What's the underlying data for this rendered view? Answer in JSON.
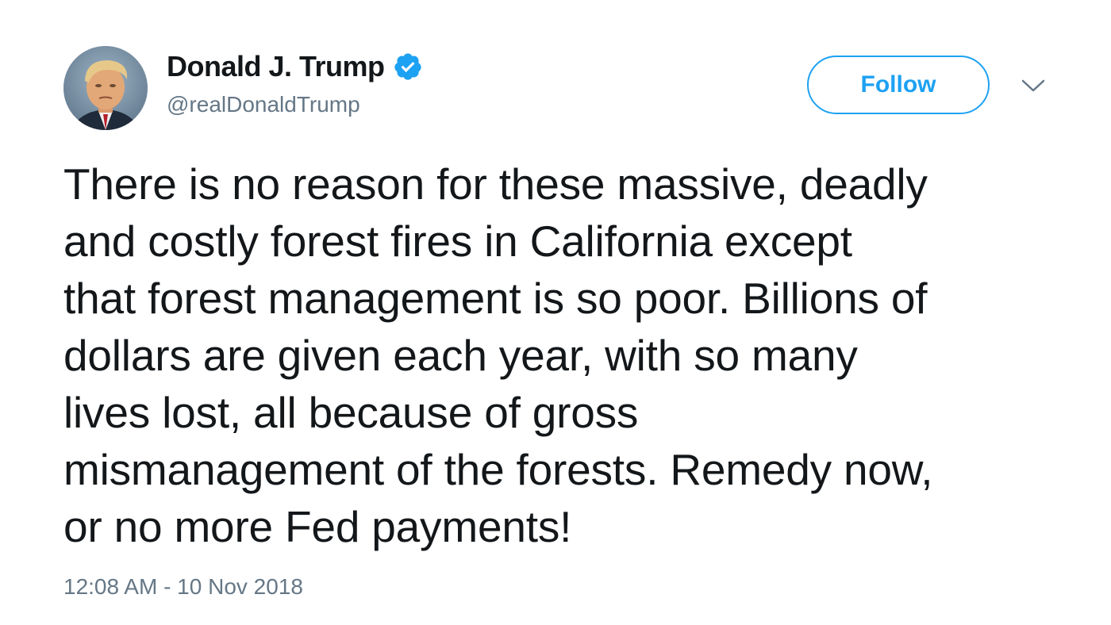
{
  "tweet": {
    "author": {
      "display_name": "Donald J. Trump",
      "handle": "@realDonaldTrump",
      "verified": true,
      "avatar_icon": "profile-photo"
    },
    "follow_label": "Follow",
    "menu_icon": "chevron-down-icon",
    "text": "There is no reason for these massive, deadly\nand costly forest fires in California except\nthat forest management is so poor. Billions of\ndollars are given each year, with so many\nlives lost, all because of gross\nmismanagement of the forests. Remedy now,\nor no more Fed payments!",
    "timestamp": "12:08 AM - 10 Nov 2018"
  },
  "colors": {
    "accent": "#1da1f2",
    "text_primary": "#14171a",
    "text_secondary": "#657786",
    "background": "#ffffff"
  }
}
